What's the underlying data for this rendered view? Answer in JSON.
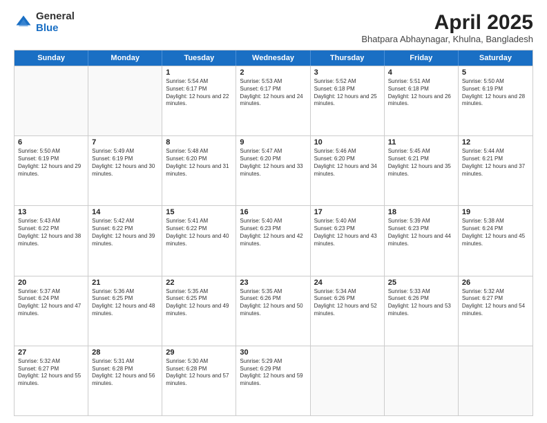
{
  "logo": {
    "general": "General",
    "blue": "Blue"
  },
  "title": "April 2025",
  "subtitle": "Bhatpara Abhaynagar, Khulna, Bangladesh",
  "weekdays": [
    "Sunday",
    "Monday",
    "Tuesday",
    "Wednesday",
    "Thursday",
    "Friday",
    "Saturday"
  ],
  "rows": [
    [
      {
        "day": "",
        "empty": true
      },
      {
        "day": "",
        "empty": true
      },
      {
        "day": "1",
        "sunrise": "5:54 AM",
        "sunset": "6:17 PM",
        "daylight": "12 hours and 22 minutes."
      },
      {
        "day": "2",
        "sunrise": "5:53 AM",
        "sunset": "6:17 PM",
        "daylight": "12 hours and 24 minutes."
      },
      {
        "day": "3",
        "sunrise": "5:52 AM",
        "sunset": "6:18 PM",
        "daylight": "12 hours and 25 minutes."
      },
      {
        "day": "4",
        "sunrise": "5:51 AM",
        "sunset": "6:18 PM",
        "daylight": "12 hours and 26 minutes."
      },
      {
        "day": "5",
        "sunrise": "5:50 AM",
        "sunset": "6:19 PM",
        "daylight": "12 hours and 28 minutes."
      }
    ],
    [
      {
        "day": "6",
        "sunrise": "5:50 AM",
        "sunset": "6:19 PM",
        "daylight": "12 hours and 29 minutes."
      },
      {
        "day": "7",
        "sunrise": "5:49 AM",
        "sunset": "6:19 PM",
        "daylight": "12 hours and 30 minutes."
      },
      {
        "day": "8",
        "sunrise": "5:48 AM",
        "sunset": "6:20 PM",
        "daylight": "12 hours and 31 minutes."
      },
      {
        "day": "9",
        "sunrise": "5:47 AM",
        "sunset": "6:20 PM",
        "daylight": "12 hours and 33 minutes."
      },
      {
        "day": "10",
        "sunrise": "5:46 AM",
        "sunset": "6:20 PM",
        "daylight": "12 hours and 34 minutes."
      },
      {
        "day": "11",
        "sunrise": "5:45 AM",
        "sunset": "6:21 PM",
        "daylight": "12 hours and 35 minutes."
      },
      {
        "day": "12",
        "sunrise": "5:44 AM",
        "sunset": "6:21 PM",
        "daylight": "12 hours and 37 minutes."
      }
    ],
    [
      {
        "day": "13",
        "sunrise": "5:43 AM",
        "sunset": "6:22 PM",
        "daylight": "12 hours and 38 minutes."
      },
      {
        "day": "14",
        "sunrise": "5:42 AM",
        "sunset": "6:22 PM",
        "daylight": "12 hours and 39 minutes."
      },
      {
        "day": "15",
        "sunrise": "5:41 AM",
        "sunset": "6:22 PM",
        "daylight": "12 hours and 40 minutes."
      },
      {
        "day": "16",
        "sunrise": "5:40 AM",
        "sunset": "6:23 PM",
        "daylight": "12 hours and 42 minutes."
      },
      {
        "day": "17",
        "sunrise": "5:40 AM",
        "sunset": "6:23 PM",
        "daylight": "12 hours and 43 minutes."
      },
      {
        "day": "18",
        "sunrise": "5:39 AM",
        "sunset": "6:23 PM",
        "daylight": "12 hours and 44 minutes."
      },
      {
        "day": "19",
        "sunrise": "5:38 AM",
        "sunset": "6:24 PM",
        "daylight": "12 hours and 45 minutes."
      }
    ],
    [
      {
        "day": "20",
        "sunrise": "5:37 AM",
        "sunset": "6:24 PM",
        "daylight": "12 hours and 47 minutes."
      },
      {
        "day": "21",
        "sunrise": "5:36 AM",
        "sunset": "6:25 PM",
        "daylight": "12 hours and 48 minutes."
      },
      {
        "day": "22",
        "sunrise": "5:35 AM",
        "sunset": "6:25 PM",
        "daylight": "12 hours and 49 minutes."
      },
      {
        "day": "23",
        "sunrise": "5:35 AM",
        "sunset": "6:26 PM",
        "daylight": "12 hours and 50 minutes."
      },
      {
        "day": "24",
        "sunrise": "5:34 AM",
        "sunset": "6:26 PM",
        "daylight": "12 hours and 52 minutes."
      },
      {
        "day": "25",
        "sunrise": "5:33 AM",
        "sunset": "6:26 PM",
        "daylight": "12 hours and 53 minutes."
      },
      {
        "day": "26",
        "sunrise": "5:32 AM",
        "sunset": "6:27 PM",
        "daylight": "12 hours and 54 minutes."
      }
    ],
    [
      {
        "day": "27",
        "sunrise": "5:32 AM",
        "sunset": "6:27 PM",
        "daylight": "12 hours and 55 minutes."
      },
      {
        "day": "28",
        "sunrise": "5:31 AM",
        "sunset": "6:28 PM",
        "daylight": "12 hours and 56 minutes."
      },
      {
        "day": "29",
        "sunrise": "5:30 AM",
        "sunset": "6:28 PM",
        "daylight": "12 hours and 57 minutes."
      },
      {
        "day": "30",
        "sunrise": "5:29 AM",
        "sunset": "6:29 PM",
        "daylight": "12 hours and 59 minutes."
      },
      {
        "day": "",
        "empty": true
      },
      {
        "day": "",
        "empty": true
      },
      {
        "day": "",
        "empty": true
      }
    ]
  ]
}
